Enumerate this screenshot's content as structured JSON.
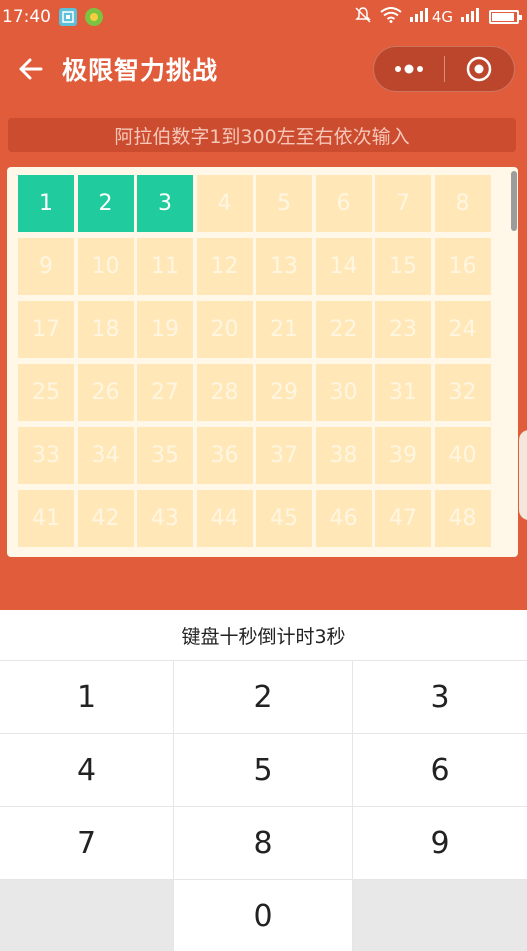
{
  "status_bar": {
    "time": "17:40",
    "network": "4G"
  },
  "nav": {
    "title": "极限智力挑战",
    "back_icon": "arrow-left-icon",
    "more_icon": "more-dots-icon",
    "close_icon": "target-circle-icon"
  },
  "instruction": "阿拉伯数字1到300左至右依次输入",
  "grid": {
    "completed_count": 3,
    "cells": [
      "1",
      "2",
      "3",
      "4",
      "5",
      "6",
      "7",
      "8",
      "9",
      "10",
      "11",
      "12",
      "13",
      "14",
      "15",
      "16",
      "17",
      "18",
      "19",
      "20",
      "21",
      "22",
      "23",
      "24",
      "25",
      "26",
      "27",
      "28",
      "29",
      "30",
      "31",
      "32",
      "33",
      "34",
      "35",
      "36",
      "37",
      "38",
      "39",
      "40",
      "41",
      "42",
      "43",
      "44",
      "45",
      "46",
      "47",
      "48"
    ]
  },
  "keyboard": {
    "countdown": "键盘十秒倒计时3秒",
    "keys": [
      "1",
      "2",
      "3",
      "4",
      "5",
      "6",
      "7",
      "8",
      "9",
      "",
      "0",
      ""
    ]
  },
  "colors": {
    "primary": "#E05C3A",
    "cell_done": "#20CC9E",
    "cell_pending": "#FFE7B8"
  }
}
